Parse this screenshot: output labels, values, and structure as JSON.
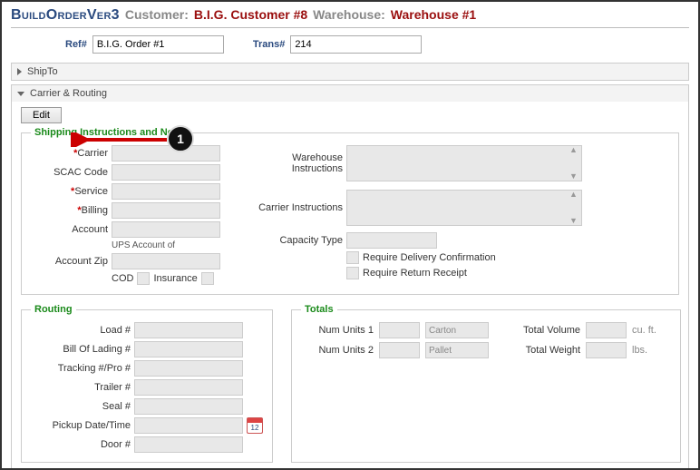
{
  "header": {
    "title": "BuildOrderVer3",
    "customer_label": "Customer:",
    "customer": "B.I.G. Customer #8",
    "warehouse_label": "Warehouse:",
    "warehouse": "Warehouse #1"
  },
  "refs": {
    "ref_label": "Ref#",
    "ref_value": "B.I.G. Order #1",
    "trans_label": "Trans#",
    "trans_value": "214"
  },
  "panels": {
    "shipto": "ShipTo",
    "carrier": "Carrier & Routing"
  },
  "edit_button": "Edit",
  "fieldsets": {
    "shipping": "Shipping Instructions and Notes",
    "routing": "Routing",
    "totals": "Totals"
  },
  "shipping": {
    "left": {
      "carrier": "Carrier",
      "scac": "SCAC Code",
      "service": "Service",
      "billing": "Billing",
      "account": "Account",
      "account_note": "UPS Account of",
      "account_zip": "Account Zip",
      "cod": "COD",
      "insurance": "Insurance"
    },
    "right": {
      "wh_instr": "Warehouse Instructions",
      "car_instr": "Carrier Instructions",
      "capacity": "Capacity Type",
      "req_deliv": "Require Delivery Confirmation",
      "req_return": "Require Return Receipt"
    }
  },
  "routing": {
    "load": "Load #",
    "bol": "Bill Of Lading #",
    "tracking": "Tracking #/Pro #",
    "trailer": "Trailer #",
    "seal": "Seal #",
    "pickup": "Pickup Date/Time",
    "door": "Door #"
  },
  "totals": {
    "num1": "Num Units 1",
    "unit1": "Carton",
    "num2": "Num Units 2",
    "unit2": "Pallet",
    "vol": "Total Volume",
    "vol_unit": "cu. ft.",
    "wt": "Total Weight",
    "wt_unit": "lbs."
  },
  "annotation": {
    "step": "1"
  }
}
